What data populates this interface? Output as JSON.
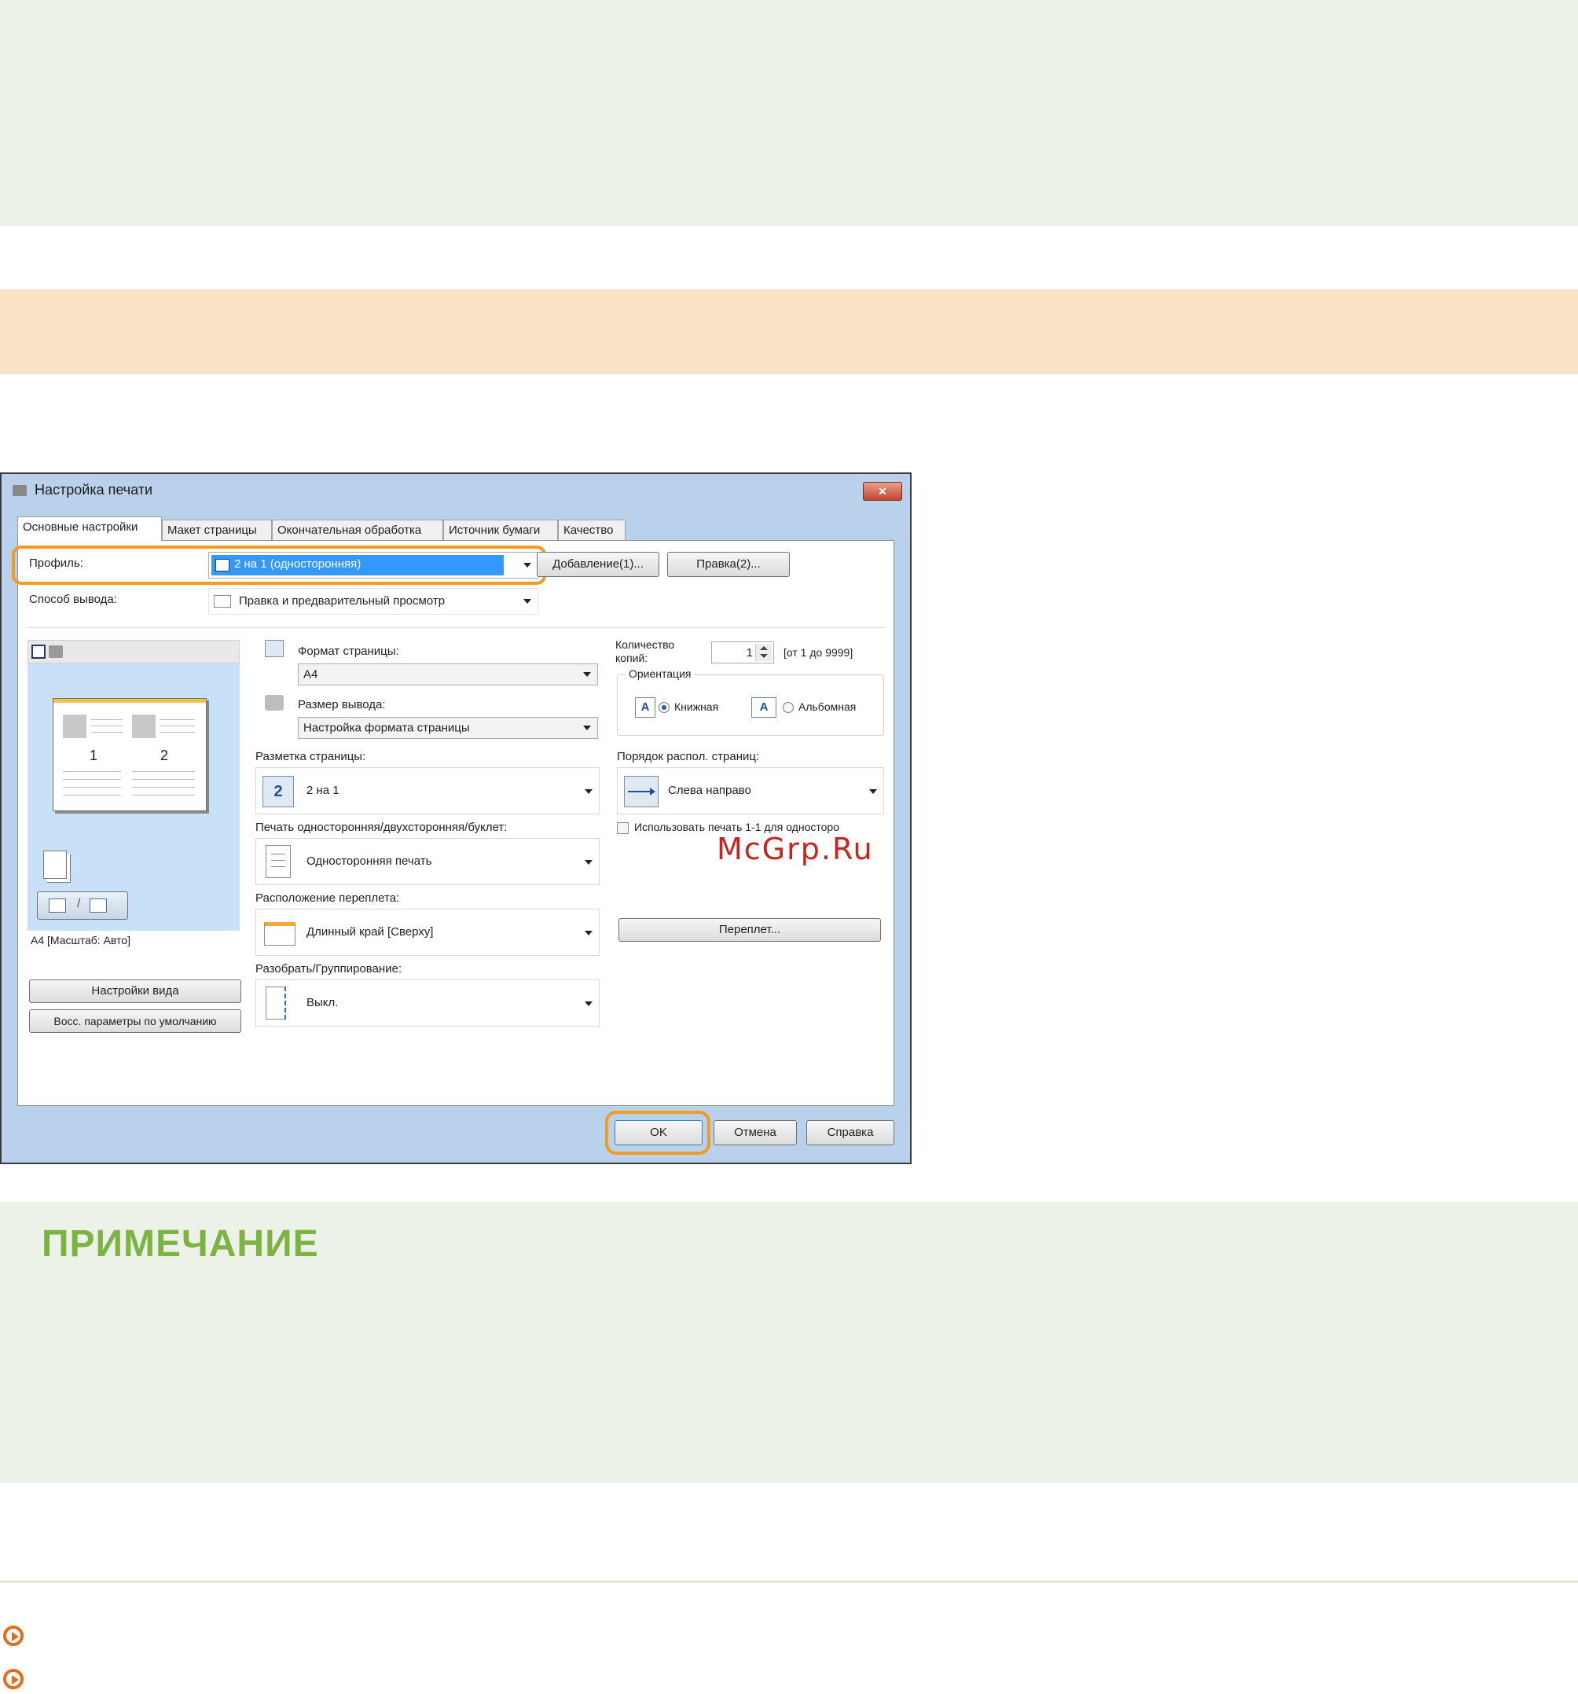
{
  "watermark": "McGrp.Ru",
  "note": {
    "title": "ПРИМЕЧАНИЕ"
  },
  "dialog": {
    "title": "Настройка печати",
    "close_label": "✕",
    "tabs": [
      {
        "label": "Основные настройки",
        "active": true
      },
      {
        "label": "Макет страницы",
        "active": false
      },
      {
        "label": "Окончательная обработка",
        "active": false
      },
      {
        "label": "Источник бумаги",
        "active": false
      },
      {
        "label": "Качество",
        "active": false
      }
    ],
    "profile": {
      "label": "Профиль:",
      "value": "2 на 1 (односторонняя)",
      "add_button": "Добавление(1)...",
      "edit_button": "Правка(2)..."
    },
    "output_method": {
      "label": "Способ вывода:",
      "value": "Правка и предварительный просмотр"
    },
    "preview": {
      "page_numbers": [
        "1",
        "2"
      ],
      "caption": "A4 [Масштаб: Авто]",
      "view_settings_button": "Настройки вида",
      "restore_defaults_button": "Восс. параметры по умолчанию"
    },
    "page_size": {
      "label": "Формат страницы:",
      "value": "A4"
    },
    "output_size": {
      "label": "Размер вывода:",
      "value": "Настройка формата страницы"
    },
    "page_layout": {
      "label": "Разметка страницы:",
      "value": "2 на 1",
      "icon_text": "2"
    },
    "print_style": {
      "label": "Печать односторонняя/двухсторонняя/буклет:",
      "value": "Односторонняя печать"
    },
    "binding_location": {
      "label": "Расположение переплета:",
      "value": "Длинный край [Сверху]"
    },
    "collate": {
      "label": "Разобрать/Группирование:",
      "value": "Выкл."
    },
    "copies": {
      "label": "Количество копий:",
      "value": "1",
      "range": "[от 1 до 9999]"
    },
    "orientation": {
      "label": "Ориентация",
      "portrait_label": "Книжная",
      "landscape_label": "Альбомная",
      "icon_text": "A",
      "selected": "portrait"
    },
    "page_order": {
      "label": "Порядок распол. страниц:",
      "value": "Слева направо"
    },
    "use_1to1_checkbox": {
      "label": "Использовать печать 1-1 для односторо",
      "checked": false
    },
    "gutter_button": "Переплет...",
    "ok_button": "OK",
    "cancel_button": "Отмена",
    "help_button": "Справка"
  }
}
